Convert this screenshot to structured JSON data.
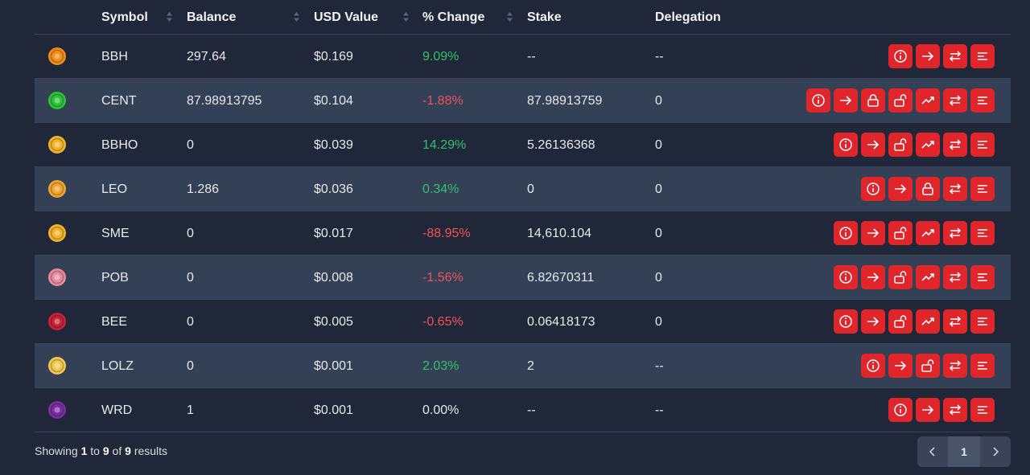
{
  "table": {
    "headers": {
      "symbol": "Symbol",
      "balance": "Balance",
      "usd": "USD Value",
      "change": "% Change",
      "stake": "Stake",
      "delegation": "Delegation"
    },
    "rows": [
      {
        "symbol": "BBH",
        "balance": "297.64",
        "usd": "$0.169",
        "change": "9.09%",
        "trend": "pos",
        "stake": "--",
        "delegation": "--",
        "icon": "bbh-token-icon",
        "iconColor": "#f28c1a",
        "actions": [
          "info",
          "transfer",
          "swap",
          "details"
        ]
      },
      {
        "symbol": "CENT",
        "balance": "87.98913795",
        "usd": "$0.104",
        "change": "-1.88%",
        "trend": "neg",
        "stake": "87.98913759",
        "delegation": "0",
        "icon": "cent-token-icon",
        "iconColor": "#2ec23a",
        "actions": [
          "info",
          "transfer",
          "lock",
          "unlock",
          "stake-chart",
          "swap",
          "details"
        ]
      },
      {
        "symbol": "BBHO",
        "balance": "0",
        "usd": "$0.039",
        "change": "14.29%",
        "trend": "pos",
        "stake": "5.26136368",
        "delegation": "0",
        "icon": "bbho-token-icon",
        "iconColor": "#f3b22b",
        "actions": [
          "info",
          "transfer",
          "unlock",
          "stake-chart",
          "swap",
          "details"
        ]
      },
      {
        "symbol": "LEO",
        "balance": "1.286",
        "usd": "$0.036",
        "change": "0.34%",
        "trend": "pos",
        "stake": "0",
        "delegation": "0",
        "icon": "leo-token-icon",
        "iconColor": "#f0a531",
        "actions": [
          "info",
          "transfer",
          "lock",
          "swap",
          "details"
        ]
      },
      {
        "symbol": "SME",
        "balance": "0",
        "usd": "$0.017",
        "change": "-88.95%",
        "trend": "neg",
        "stake": "14,610.104",
        "delegation": "0",
        "icon": "sme-token-icon",
        "iconColor": "#f3b22b",
        "actions": [
          "info",
          "transfer",
          "unlock",
          "stake-chart",
          "swap",
          "details"
        ]
      },
      {
        "symbol": "POB",
        "balance": "0",
        "usd": "$0.008",
        "change": "-1.56%",
        "trend": "neg",
        "stake": "6.82670311",
        "delegation": "0",
        "icon": "pob-token-icon",
        "iconColor": "#e88aa0",
        "actions": [
          "info",
          "transfer",
          "unlock",
          "stake-chart",
          "swap",
          "details"
        ]
      },
      {
        "symbol": "BEE",
        "balance": "0",
        "usd": "$0.005",
        "change": "-0.65%",
        "trend": "neg",
        "stake": "0.06418173",
        "delegation": "0",
        "icon": "bee-token-icon",
        "iconColor": "#c9223a",
        "actions": [
          "info",
          "transfer",
          "unlock",
          "stake-chart",
          "swap",
          "details"
        ]
      },
      {
        "symbol": "LOLZ",
        "balance": "0",
        "usd": "$0.001",
        "change": "2.03%",
        "trend": "pos",
        "stake": "2",
        "delegation": "--",
        "icon": "lolz-token-icon",
        "iconColor": "#f2c94c",
        "actions": [
          "info",
          "transfer",
          "unlock",
          "swap",
          "details"
        ]
      },
      {
        "symbol": "WRD",
        "balance": "1",
        "usd": "$0.001",
        "change": "0.00%",
        "trend": "neu",
        "stake": "--",
        "delegation": "--",
        "icon": "wrd-token-icon",
        "iconColor": "#7a2fa0",
        "actions": [
          "info",
          "transfer",
          "swap",
          "details"
        ]
      }
    ]
  },
  "footer": {
    "showing": "Showing",
    "from": "1",
    "to_word": "to",
    "to": "9",
    "of_word": "of",
    "total": "9",
    "results": "results"
  },
  "pagination": {
    "current": "1"
  },
  "colors": {
    "accent": "#e0262b",
    "positive": "#2fc36b",
    "negative": "#f0535a",
    "background": "#1f2738",
    "row_alt": "#334056"
  }
}
